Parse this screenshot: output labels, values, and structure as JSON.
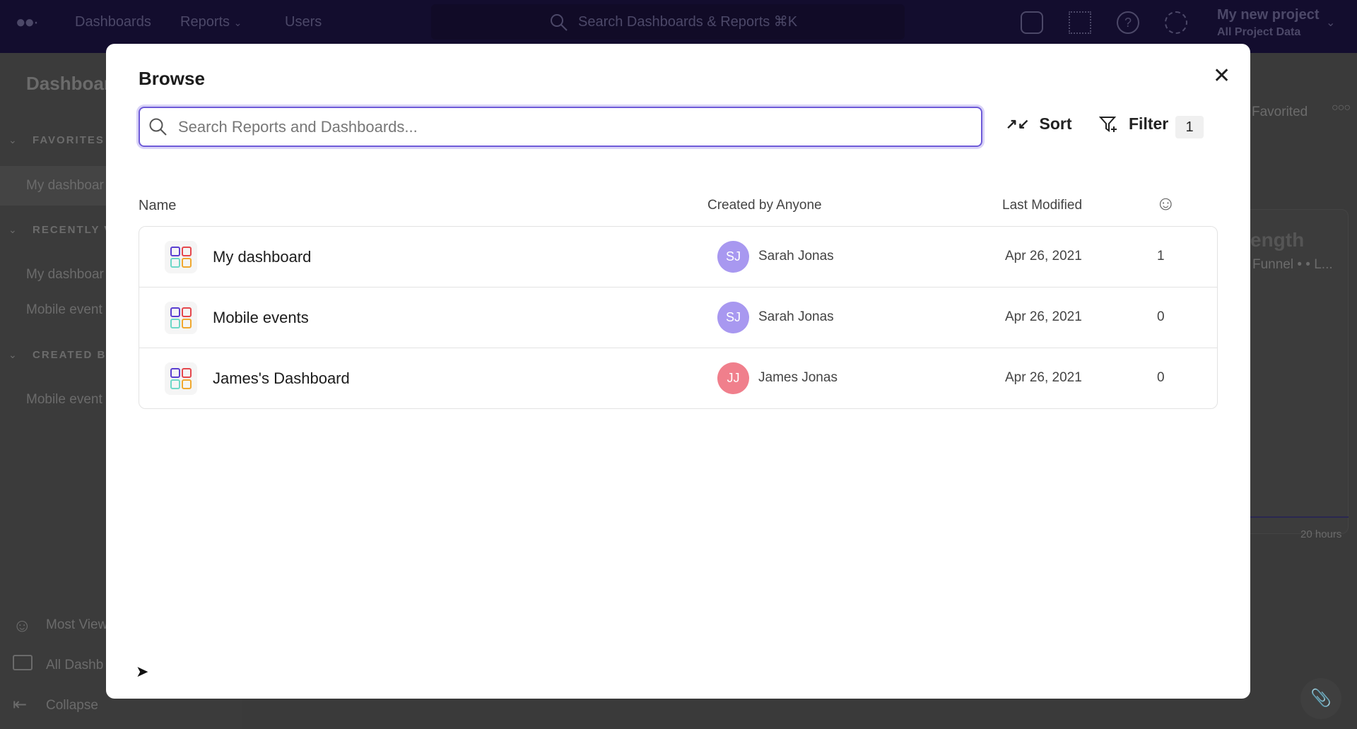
{
  "nav": {
    "items": [
      "Dashboards",
      "Reports",
      "Users"
    ],
    "search_placeholder": "Search Dashboards & Reports ⌘K",
    "project_name": "My new project",
    "project_scope": "All Project Data",
    "icons": [
      "database-icon",
      "apps-grid-icon",
      "help-icon",
      "gear-icon"
    ]
  },
  "sidebar": {
    "title": "Dashboar",
    "sections": [
      "FAVORITES",
      "RECENTLY V",
      "CREATED B"
    ],
    "items": [
      "My dashboar",
      "My dashboar",
      "Mobile event",
      "Mobile event"
    ],
    "bottom": [
      "Most View",
      "All Dashb",
      "Collapse"
    ]
  },
  "background": {
    "favorited": "Favorited",
    "card_title": "ength",
    "card_subtitle": "Funnel • • L...",
    "time_label": "20 hours"
  },
  "modal": {
    "title": "Browse",
    "search_placeholder": "Search Reports and Dashboards...",
    "sort_label": "Sort",
    "filter_label": "Filter",
    "filter_count": "1",
    "columns": {
      "name": "Name",
      "created_by": "Created by Anyone",
      "last_modified": "Last Modified"
    },
    "rows": [
      {
        "name": "My dashboard",
        "initials": "SJ",
        "creator": "Sarah Jonas",
        "avatar_color": "#a898f0",
        "modified": "Apr 26, 2021",
        "count": "1"
      },
      {
        "name": "Mobile events",
        "initials": "SJ",
        "creator": "Sarah Jonas",
        "avatar_color": "#a898f0",
        "modified": "Apr 26, 2021",
        "count": "0"
      },
      {
        "name": "James's Dashboard",
        "initials": "JJ",
        "creator": "James Jonas",
        "avatar_color": "#f07f8c",
        "modified": "Apr 26, 2021",
        "count": "0"
      }
    ]
  },
  "colors": {
    "accent": "#6e5bd8",
    "nav_bg": "#130d2e"
  }
}
